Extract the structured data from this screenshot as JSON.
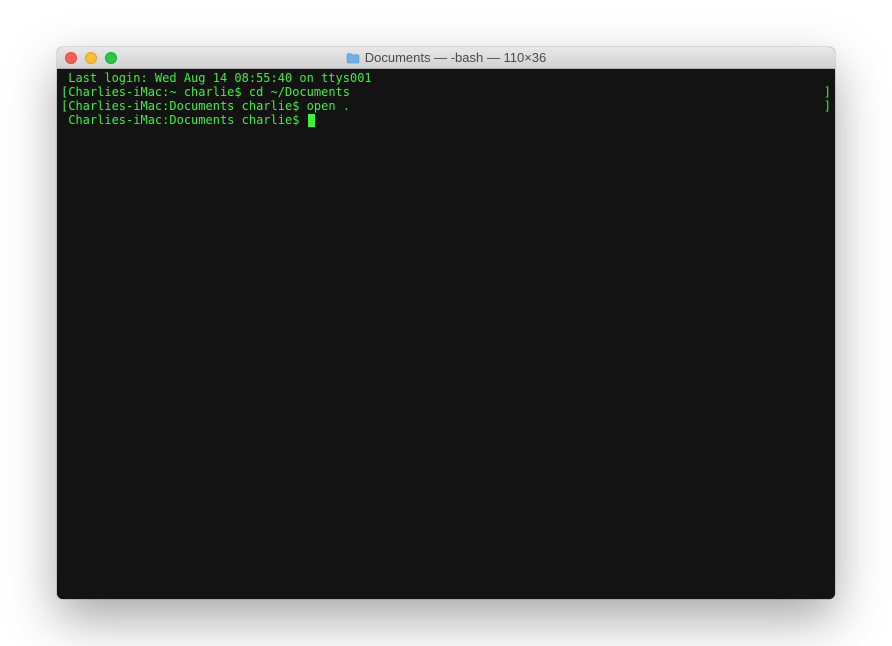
{
  "window": {
    "title": "Documents — -bash — 110×36"
  },
  "terminal": {
    "lines": [
      {
        "left_bracket": "",
        "text": " Last login: Wed Aug 14 08:55:40 on ttys001",
        "right_bracket": ""
      },
      {
        "left_bracket": "[",
        "text": "Charlies-iMac:~ charlie$ cd ~/Documents",
        "right_bracket": "]"
      },
      {
        "left_bracket": "[",
        "text": "Charlies-iMac:Documents charlie$ open .",
        "right_bracket": "]"
      },
      {
        "left_bracket": "",
        "text": " Charlies-iMac:Documents charlie$ ",
        "right_bracket": ""
      }
    ]
  }
}
